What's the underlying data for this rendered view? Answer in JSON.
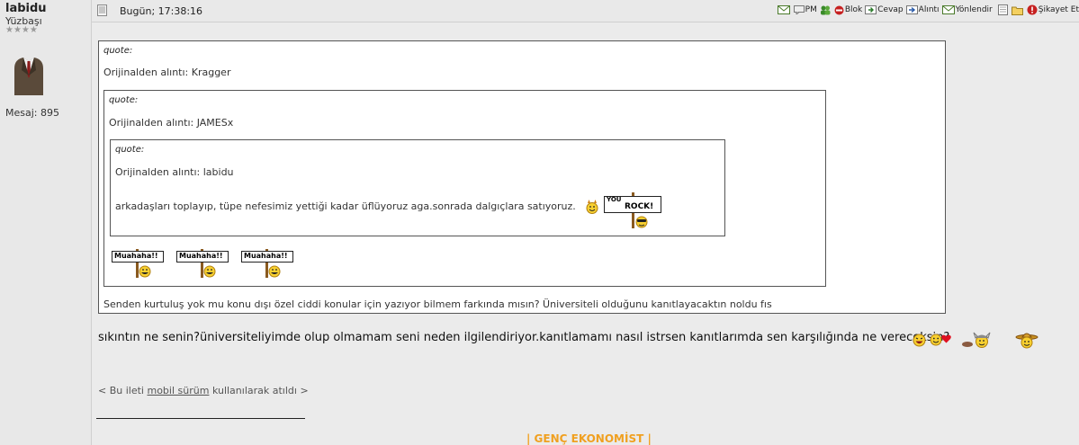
{
  "user": {
    "name": "labidu",
    "rank": "Yüzbaşı",
    "stars": "★★★★",
    "message_count": "Mesaj: 895"
  },
  "post": {
    "datetime": "Bugün; 17:38:16",
    "actions": {
      "pm": "PM",
      "block": "Blok",
      "reply": "Cevap",
      "quote": "Alıntı",
      "forward": "Yönlendir",
      "report": "Şikayet Et"
    },
    "quotes": {
      "outer": {
        "label": "quote:",
        "source": "Orijinalden alıntı: Kragger",
        "text": "Senden kurtuluş yok mu konu dışı özel ciddi konular için yazıyor bilmem farkında mısın? Üniversiteli olduğunu kanıtlayacaktın noldu fıs"
      },
      "middle": {
        "label": "quote:",
        "source": "Orijinalden alıntı: JAMESx",
        "signs": [
          "Muahaha!!",
          "Muahaha!!",
          "Muahaha!!"
        ]
      },
      "inner": {
        "label": "quote:",
        "source": "Orijinalden alıntı: labidu",
        "text": "arkadaşları toplayıp, tüpe nefesimiz yettiği kadar üflüyoruz aga.sonrada dalgıçlara satıyoruz.",
        "sign_top": "YOU",
        "sign_bottom": "ROCK!"
      }
    },
    "body": "sıkıntın ne senin?üniversiteliyimde olup olmamam seni neden ilgilendiriyor.kanıtlamamı nasıl istrsen kanıtlarımda sen karşılığında ne vereceksin?",
    "mobile": {
      "prefix": "< Bu ileti",
      "link": "mobil sürüm",
      "suffix": "kullanılarak atıldı >"
    },
    "signature_title": "| GENÇ EKONOMİST |"
  }
}
